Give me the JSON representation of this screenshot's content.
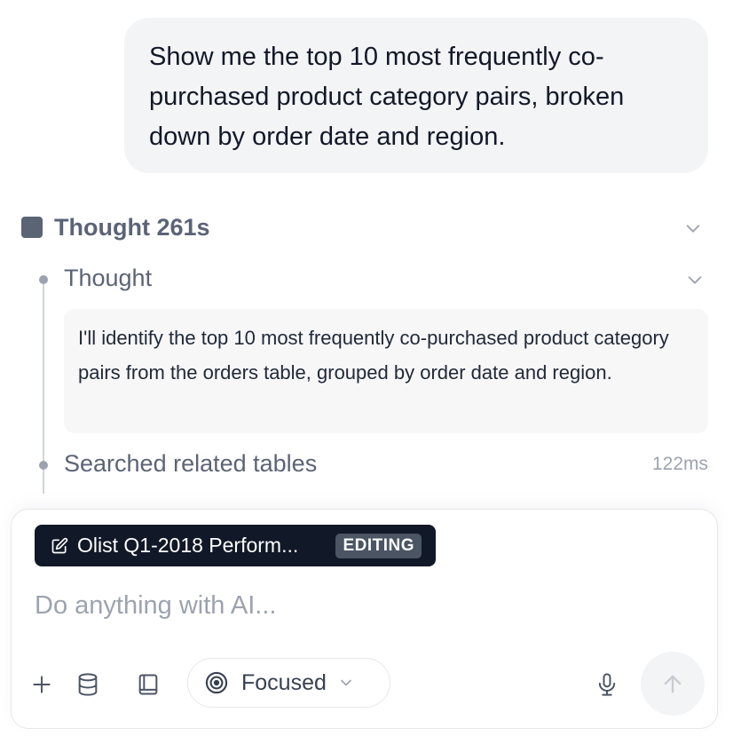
{
  "conversation": {
    "user_message": "Show me the top 10 most frequently co-purchased product category pairs, broken down by order date and region."
  },
  "reasoning": {
    "header_label": "Thought 261s",
    "steps": [
      {
        "label": "Thought",
        "content": "I'll identify the top 10 most frequently co-purchased product category pairs from the orders table, grouped by order date and region."
      },
      {
        "label": "Searched related tables",
        "duration": "122ms"
      }
    ]
  },
  "composer": {
    "context_chip": {
      "title": "Olist Q1-2018 Perform...",
      "badge": "EDITING"
    },
    "placeholder": "Do anything with AI...",
    "value": "",
    "mode": {
      "selected": "Focused"
    }
  },
  "icons": {
    "edit": "pencil-square-icon",
    "add": "plus-icon",
    "database": "database-icon",
    "book": "book-icon",
    "mode": "target-icon",
    "dropdown": "chevron-down-icon",
    "mic": "microphone-icon",
    "send": "arrow-up-icon"
  },
  "colors": {
    "chip_bg": "#111827",
    "muted_text": "#5b6475",
    "bubble_bg": "#f3f4f6"
  }
}
